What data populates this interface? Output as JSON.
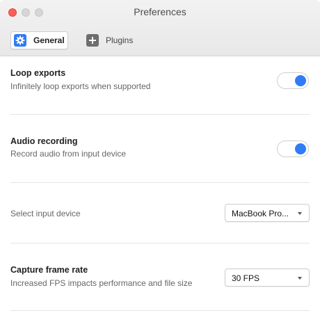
{
  "window": {
    "title": "Preferences"
  },
  "tabs": [
    {
      "label": "General",
      "icon": "gear-icon",
      "selected": true
    },
    {
      "label": "Plugins",
      "icon": "plus-icon",
      "selected": false
    }
  ],
  "settings": {
    "loop_exports": {
      "title": "Loop exports",
      "description": "Infinitely loop exports when supported",
      "enabled": true
    },
    "audio_recording": {
      "title": "Audio recording",
      "description": "Record audio from input device",
      "enabled": true
    },
    "input_device": {
      "label": "Select input device",
      "selected": "MacBook Pro..."
    },
    "frame_rate": {
      "title": "Capture frame rate",
      "description": "Increased FPS impacts performance and file size",
      "selected": "30 FPS"
    }
  },
  "colors": {
    "accent": "#2f7cf6",
    "close_button": "#fe5f57"
  }
}
